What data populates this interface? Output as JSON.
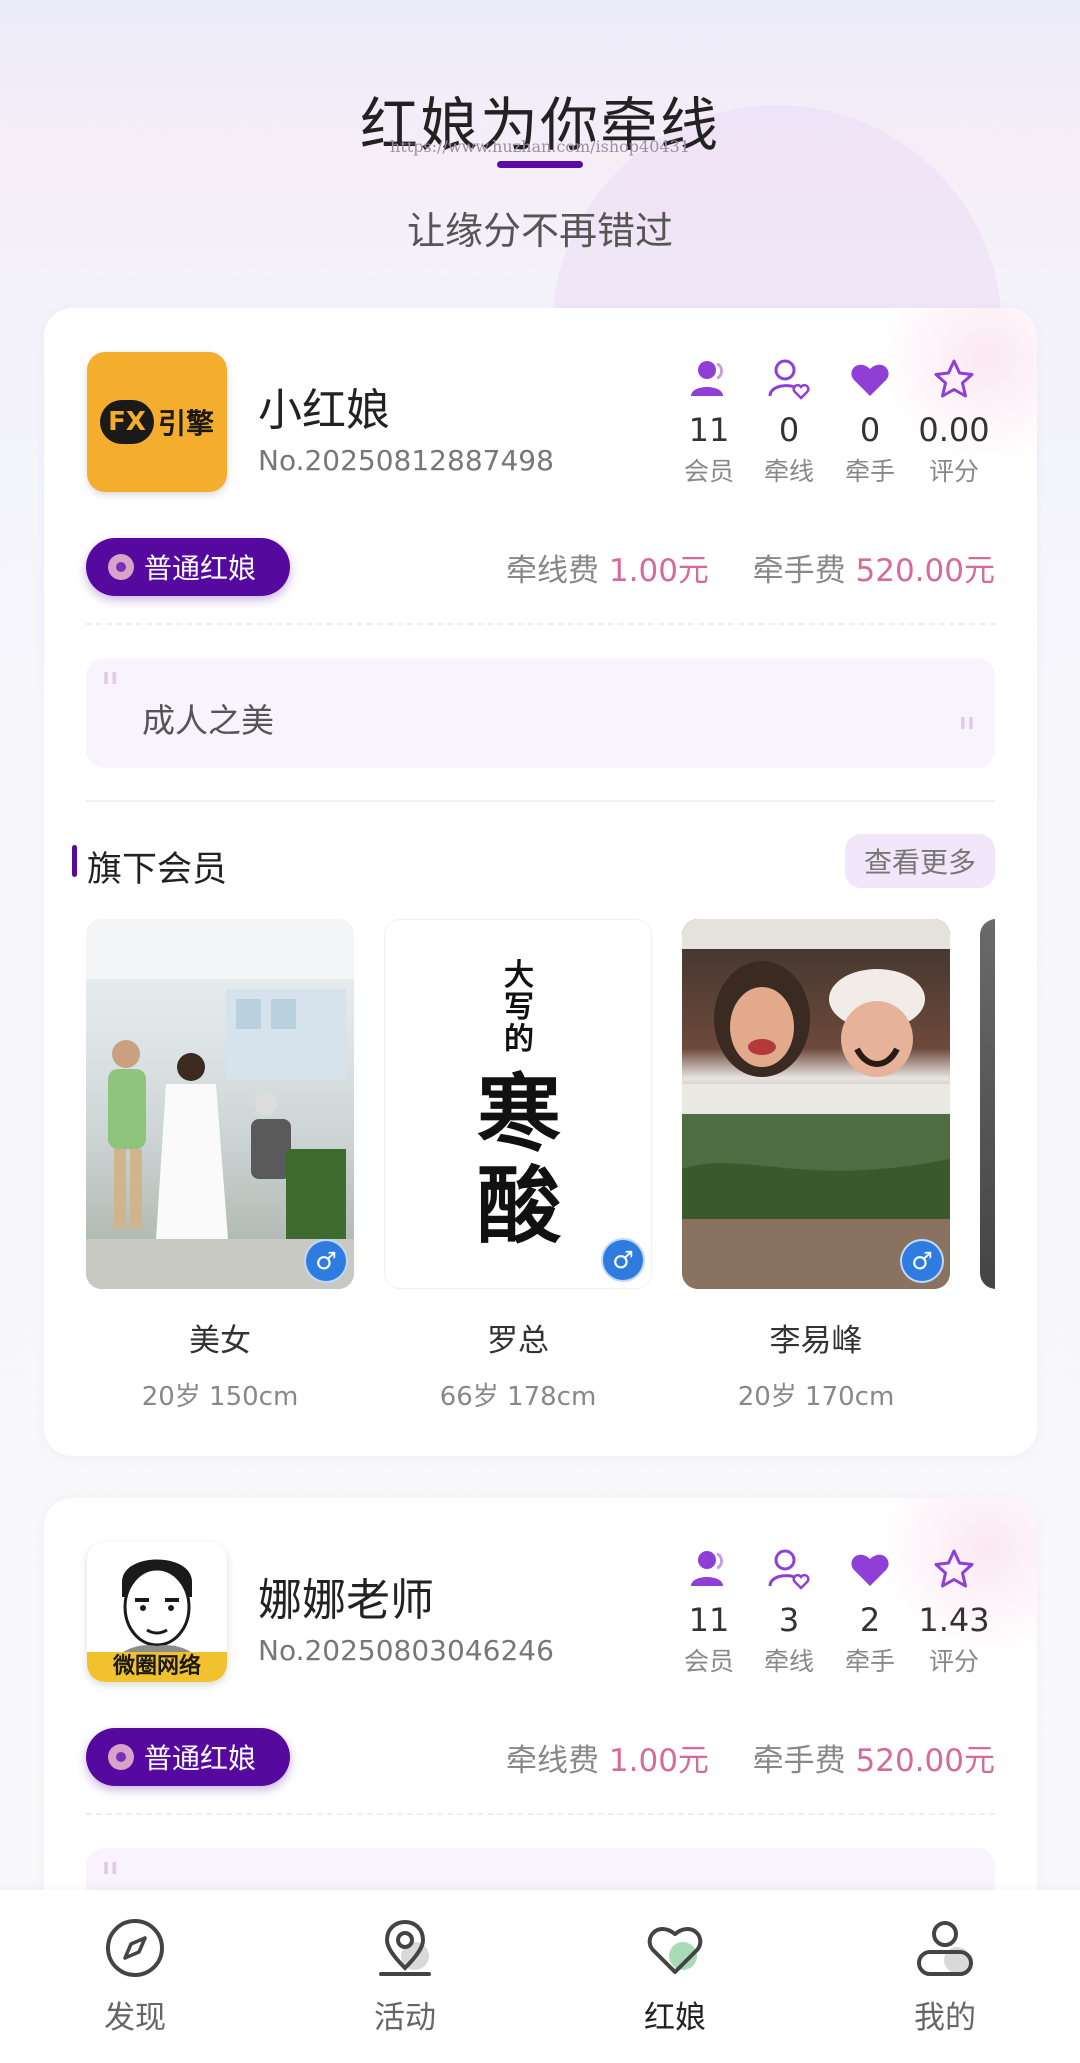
{
  "header": {
    "title": "红娘为你牵线",
    "watermark": "https://www.huzhan.com/ishop40431",
    "subtitle": "让缘分不再错过"
  },
  "matchmakers": [
    {
      "name": "小红娘",
      "number": "No.20250812887498",
      "avatar_text": "引擎",
      "avatar_logo": "FX",
      "stats": [
        {
          "value": "11",
          "label": "会员",
          "icon": "members-icon"
        },
        {
          "value": "0",
          "label": "牵线",
          "icon": "match-icon"
        },
        {
          "value": "0",
          "label": "牵手",
          "icon": "heart-icon"
        },
        {
          "value": "0.00",
          "label": "评分",
          "icon": "star-icon"
        }
      ],
      "badge": "普通红娘",
      "fee_match_label": "牵线费",
      "fee_match_value": "1.00元",
      "fee_hand_label": "牵手费",
      "fee_hand_value": "520.00元",
      "motto": "成人之美",
      "members_title": "旗下会员",
      "more_label": "查看更多",
      "members": [
        {
          "name": "美女",
          "meta": "20岁 150cm",
          "gender": "♂"
        },
        {
          "name": "罗总",
          "meta": "66岁 178cm",
          "gender": "♂",
          "photo_text_small": "大写的",
          "photo_text_big": "寒酸"
        },
        {
          "name": "李易峰",
          "meta": "20岁 170cm",
          "gender": "♂"
        }
      ]
    },
    {
      "name": "娜娜老师",
      "number": "No.20250803046246",
      "avatar_banner": "微圈网络",
      "stats": [
        {
          "value": "11",
          "label": "会员",
          "icon": "members-icon"
        },
        {
          "value": "3",
          "label": "牵线",
          "icon": "match-icon"
        },
        {
          "value": "2",
          "label": "牵手",
          "icon": "heart-icon"
        },
        {
          "value": "1.43",
          "label": "评分",
          "icon": "star-icon"
        }
      ],
      "badge": "普通红娘",
      "fee_match_label": "牵线费",
      "fee_match_value": "1.00元",
      "fee_hand_label": "牵手费",
      "fee_hand_value": "520.00元"
    }
  ],
  "nav": [
    {
      "label": "发现",
      "icon": "compass-icon",
      "active": false
    },
    {
      "label": "活动",
      "icon": "location-icon",
      "active": false
    },
    {
      "label": "红娘",
      "icon": "heart-nav-icon",
      "active": true
    },
    {
      "label": "我的",
      "icon": "user-icon",
      "active": false
    }
  ],
  "colors": {
    "brand_purple": "#55099f",
    "icon_purple": "#8f3fd6",
    "fee_pink": "#d66a9e",
    "gender_blue": "#2f7ce0"
  }
}
